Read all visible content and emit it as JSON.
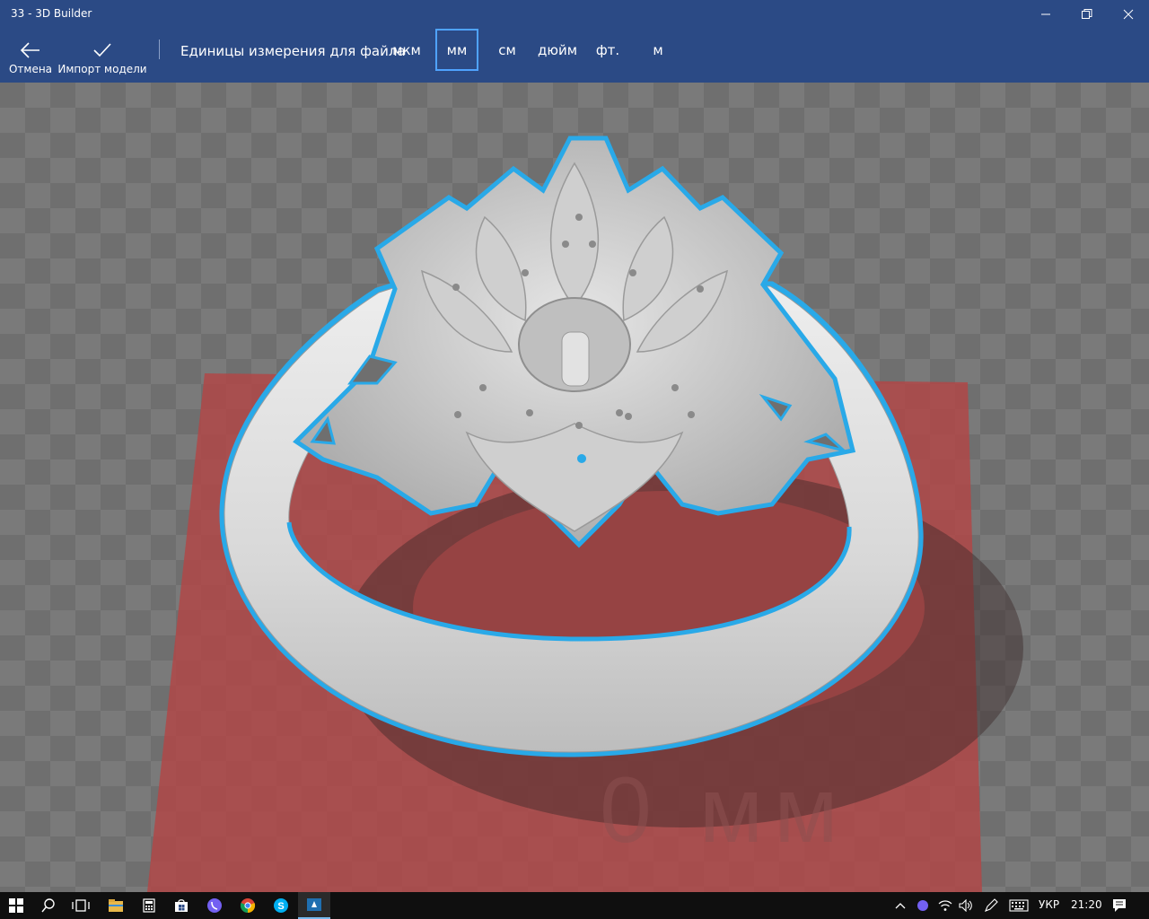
{
  "window": {
    "title": "33 - 3D Builder",
    "controls": [
      "minimize-icon",
      "restore-icon",
      "close-icon"
    ]
  },
  "commandbar": {
    "cancel_label": "Отмена",
    "import_label": "Импорт модели",
    "units_label": "Единицы измерения для файла",
    "units": [
      "мкм",
      "мм",
      "см",
      "дюйм",
      "фт.",
      "м"
    ],
    "selected_unit": "мм"
  },
  "viewport": {
    "scale_label": "0 мм",
    "model": "ring",
    "selection_color": "#29a9e8",
    "platform_color": "#b04848"
  },
  "taskbar": {
    "apps": [
      "file-explorer-icon",
      "calculator-icon",
      "store-icon",
      "viber-icon",
      "chrome-icon",
      "skype-icon",
      "3d-builder-icon"
    ],
    "language": "УКР",
    "time": "21:20"
  }
}
